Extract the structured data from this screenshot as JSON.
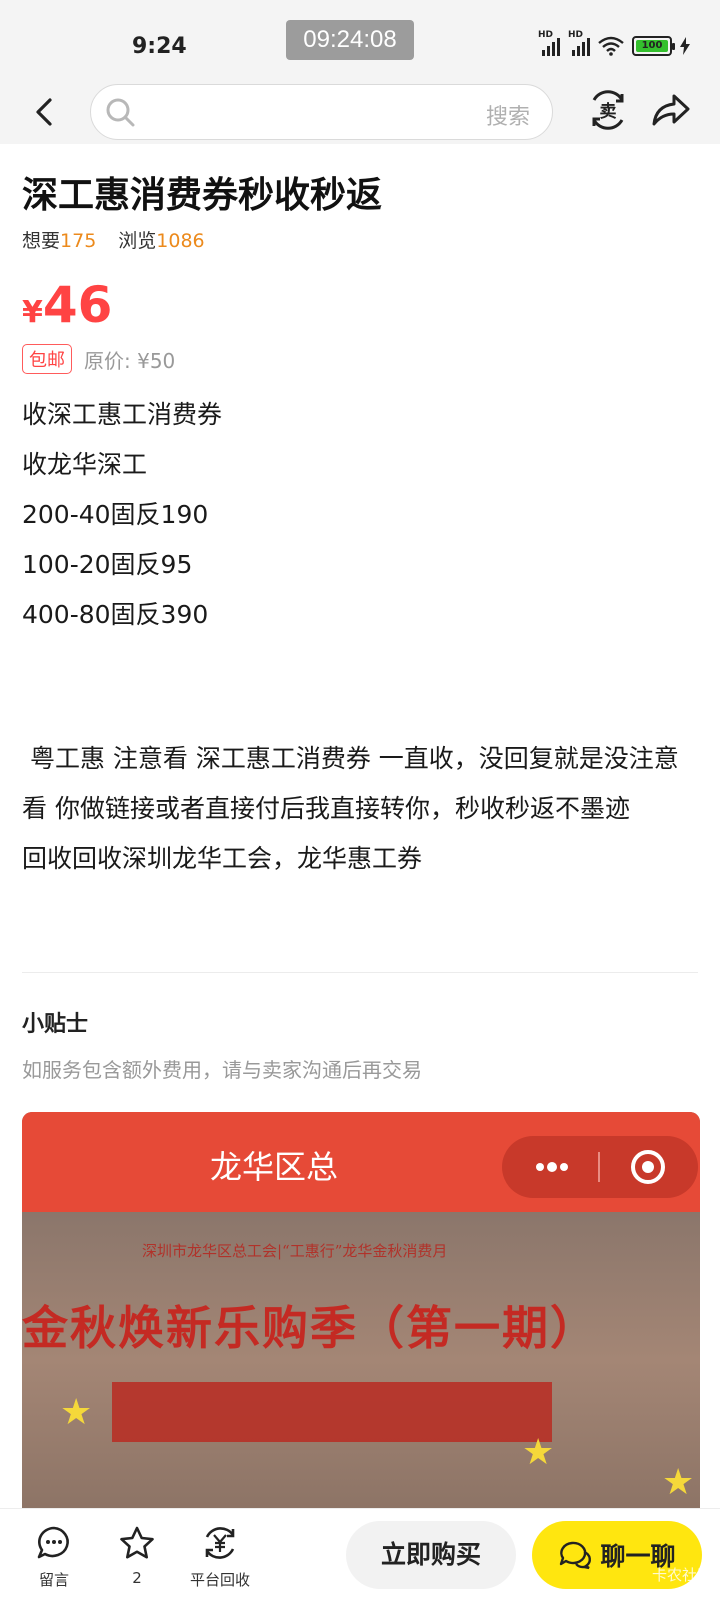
{
  "status_bar": {
    "time": "9:24",
    "clock_badge": "09:24:08",
    "battery": "100",
    "hd_label": "HD"
  },
  "nav": {
    "search_placeholder": "搜索"
  },
  "item": {
    "title": "深工惠消费券秒收秒返",
    "want_label": "想要",
    "want_count": "175",
    "view_label": "浏览",
    "view_count": "1086",
    "currency": "¥",
    "price": "46",
    "free_shipping": "包邮",
    "original_price": "原价: ¥50",
    "description_lines": [
      "收深工惠工消费券",
      "收龙华深工",
      "200-40固反190",
      "100-20固反95",
      "400-80固反390"
    ],
    "paragraph": " 粤工惠 注意看 深工惠工消费券 一直收，没回复就是没注意看 你做链接或者直接付后我直接转你，秒收秒返不墨迹\n回收回收深圳龙华工会，龙华惠工券"
  },
  "tips": {
    "title": "小贴士",
    "text": "如服务包含额外费用，请与卖家沟通后再交易"
  },
  "image": {
    "header_title": "龙华区总",
    "caption": "深圳市龙华区总工会|“工惠行”龙华金秋消费月",
    "slogan": "金秋焕新乐购季（第一期）"
  },
  "bottom_bar": {
    "comment_label": "留言",
    "favorite_count": "2",
    "recycle_label": "平台回收",
    "buy_label": "立即购买",
    "chat_label": "聊一聊"
  },
  "watermark": "卡农社区",
  "colors": {
    "price_red": "#ff4343",
    "count_orange": "#ec8a1c",
    "chat_yellow": "#ffe60f"
  }
}
